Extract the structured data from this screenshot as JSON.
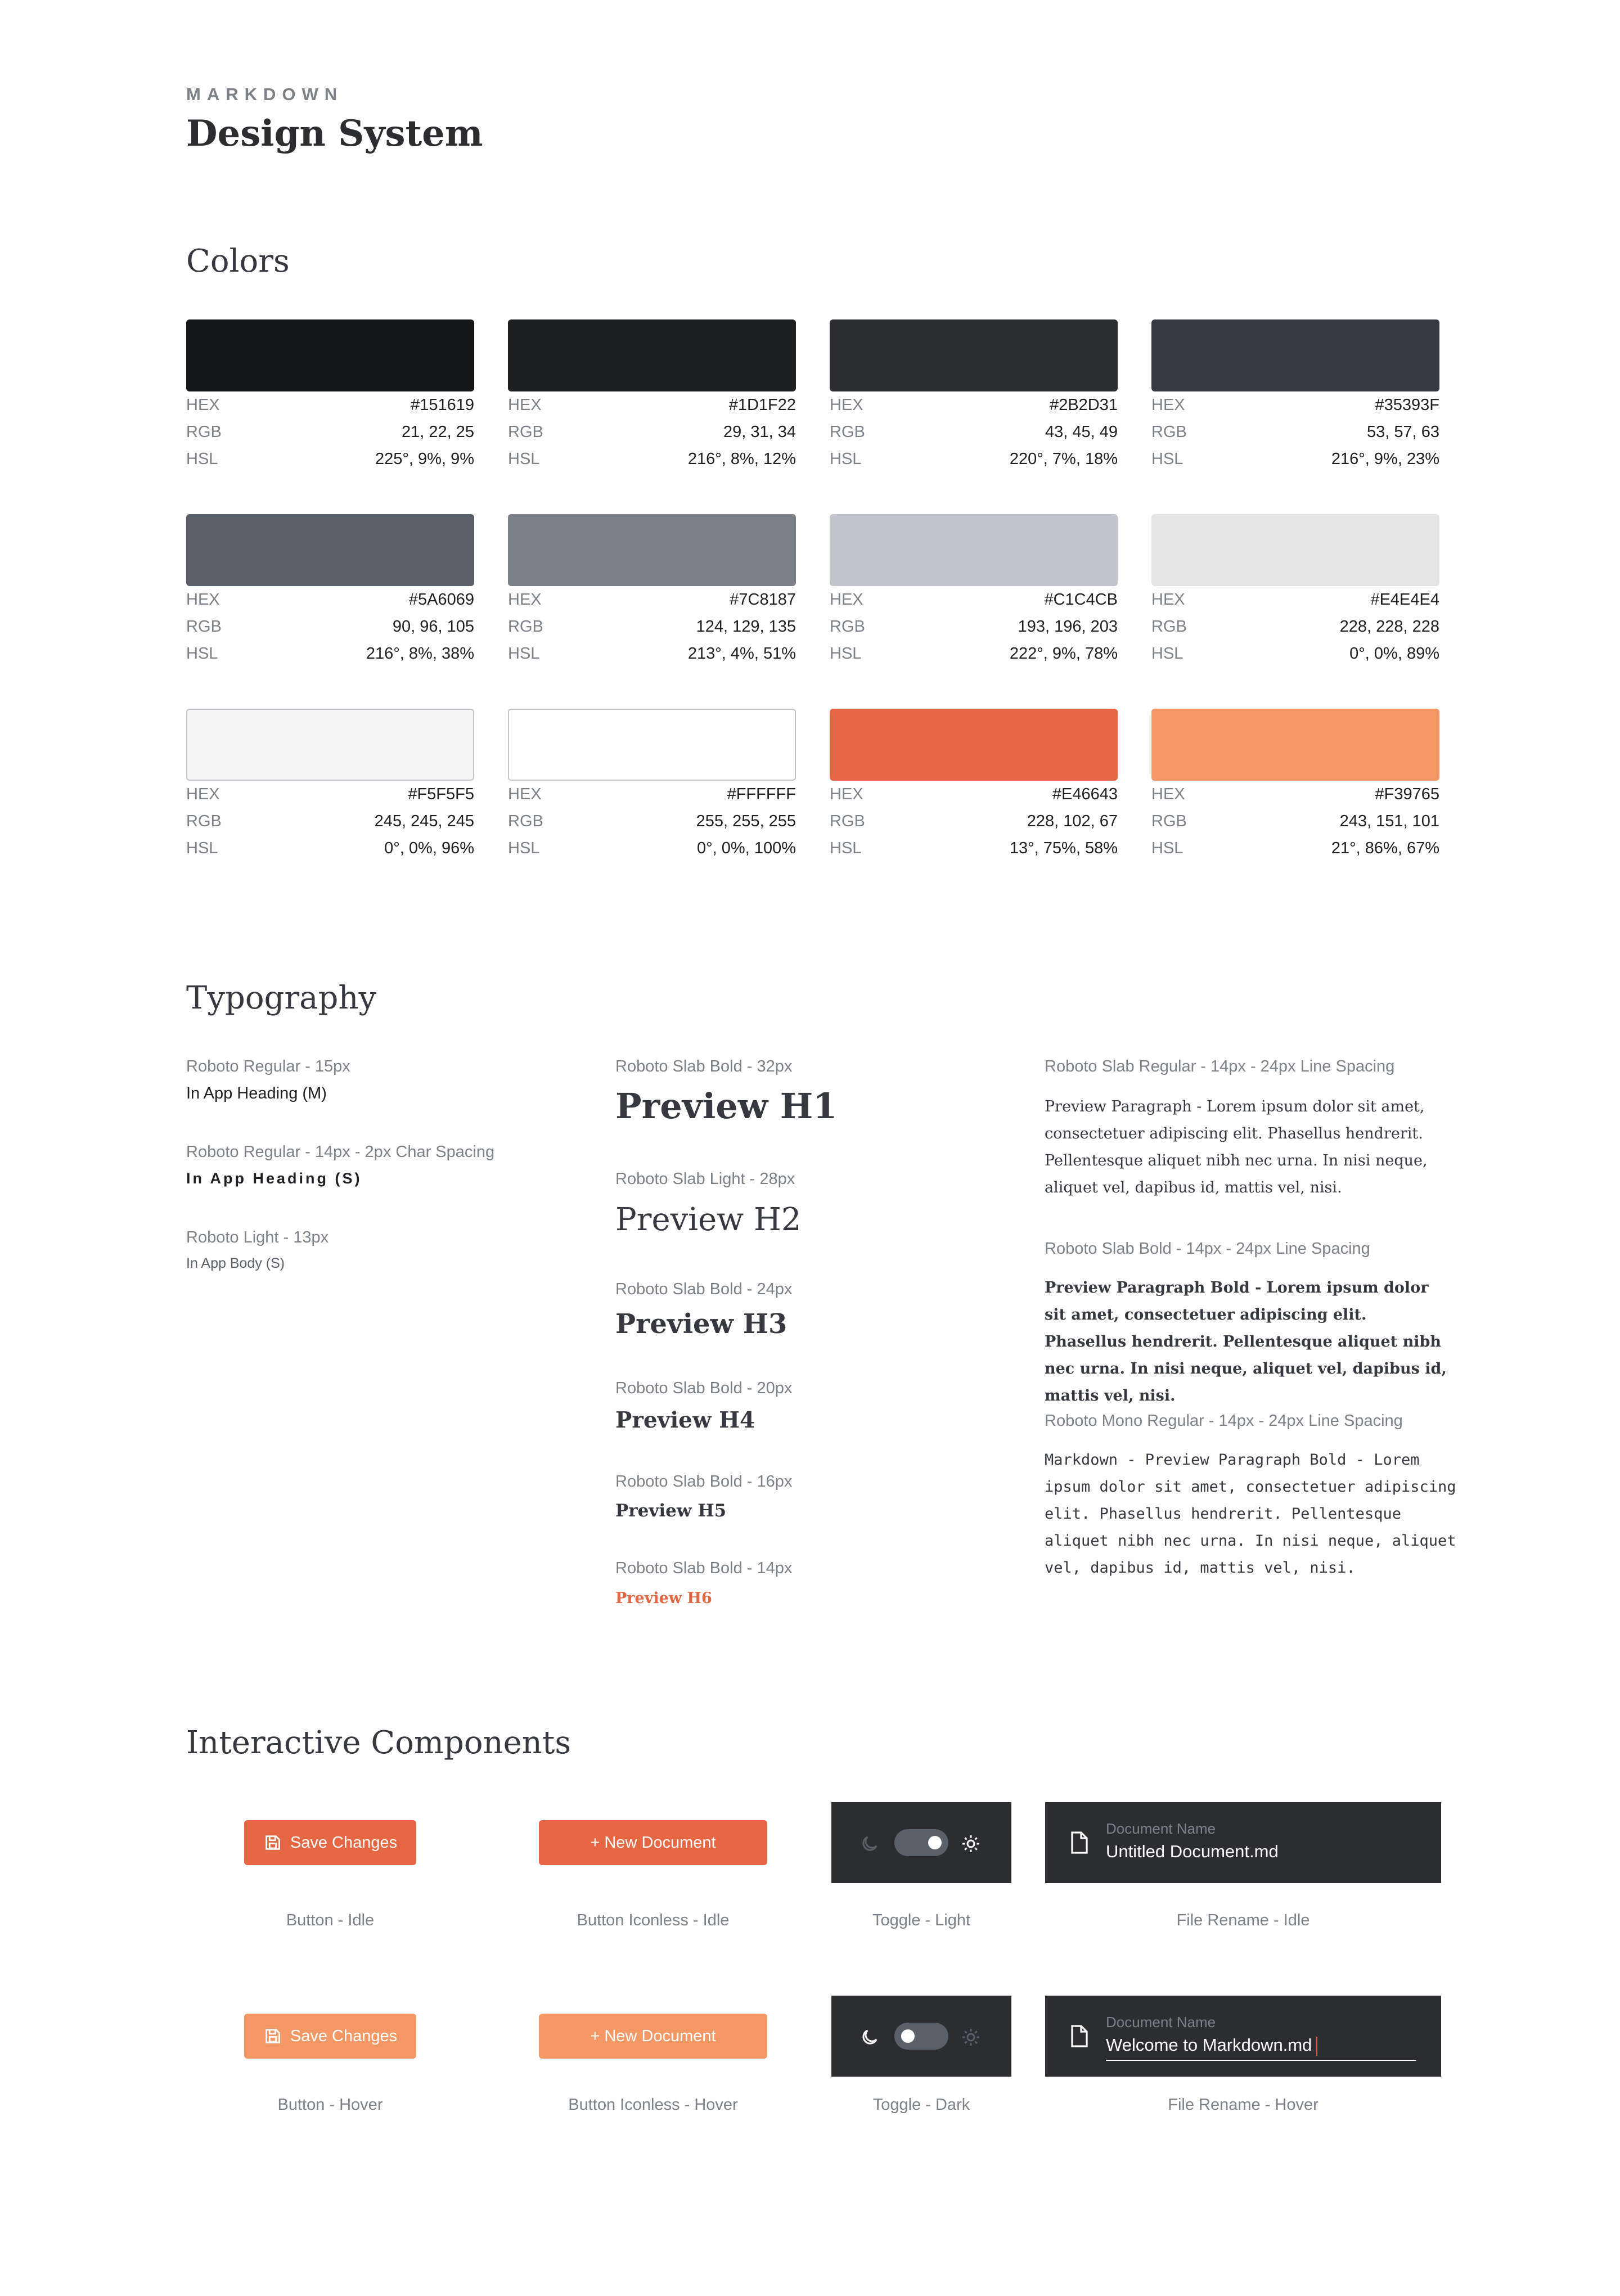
{
  "header": {
    "brand": "MARKDOWN",
    "title": "Design System"
  },
  "sections": {
    "colors": "Colors",
    "typography": "Typography",
    "components": "Interactive Components"
  },
  "colors": [
    {
      "hex": "#151619",
      "rgb": "21, 22, 25",
      "hsl": "225°, 9%, 9%"
    },
    {
      "hex": "#1D1F22",
      "rgb": "29, 31, 34",
      "hsl": "216°, 8%, 12%"
    },
    {
      "hex": "#2B2D31",
      "rgb": "43, 45, 49",
      "hsl": "220°, 7%, 18%"
    },
    {
      "hex": "#35393F",
      "rgb": "53, 57, 63",
      "hsl": "216°, 9%, 23%"
    },
    {
      "hex": "#5A6069",
      "rgb": "90, 96, 105",
      "hsl": "216°, 8%, 38%"
    },
    {
      "hex": "#7C8187",
      "rgb": "124, 129, 135",
      "hsl": "213°, 4%, 51%"
    },
    {
      "hex": "#C1C4CB",
      "rgb": "193, 196, 203",
      "hsl": "222°, 9%, 78%"
    },
    {
      "hex": "#E4E4E4",
      "rgb": "228, 228, 228",
      "hsl": "0°, 0%, 89%"
    },
    {
      "hex": "#F5F5F5",
      "rgb": "245, 245, 245",
      "hsl": "0°, 0%, 96%"
    },
    {
      "hex": "#FFFFFF",
      "rgb": "255, 255, 255",
      "hsl": "0°, 0%, 100%"
    },
    {
      "hex": "#E46643",
      "rgb": "228, 102, 67",
      "hsl": "13°, 75%, 58%"
    },
    {
      "hex": "#F39765",
      "rgb": "243, 151, 101",
      "hsl": "21°, 86%, 67%"
    }
  ],
  "color_keys": {
    "hex": "HEX",
    "rgb": "RGB",
    "hsl": "HSL"
  },
  "typography": {
    "left": [
      {
        "label": "Roboto Regular - 15px",
        "sample": "In App Heading (M)"
      },
      {
        "label": "Roboto Regular - 14px - 2px Char Spacing",
        "sample": "In App Heading (S)"
      },
      {
        "label": "Roboto Light - 13px",
        "sample": "In App Body (S)"
      }
    ],
    "middle": [
      {
        "label": "Roboto Slab Bold - 32px",
        "sample": "Preview H1"
      },
      {
        "label": "Roboto Slab Light - 28px",
        "sample": "Preview H2"
      },
      {
        "label": "Roboto Slab Bold - 24px",
        "sample": "Preview H3"
      },
      {
        "label": "Roboto Slab Bold - 20px",
        "sample": "Preview H4"
      },
      {
        "label": "Roboto Slab Bold - 16px",
        "sample": "Preview H5"
      },
      {
        "label": "Roboto Slab Bold - 14px",
        "sample": "Preview H6"
      }
    ],
    "right": [
      {
        "label": "Roboto Slab Regular - 14px - 24px Line Spacing",
        "sample": "Preview Paragraph - Lorem ipsum dolor sit amet, consectetuer adipiscing elit. Phasellus hendrerit. Pellentesque aliquet nibh nec urna. In nisi neque, aliquet vel, dapibus id, mattis vel, nisi."
      },
      {
        "label": "Roboto Slab Bold - 14px - 24px Line Spacing",
        "sample": "Preview Paragraph Bold -  Lorem ipsum dolor sit amet, consectetuer adipiscing elit. Phasellus hendrerit. Pellentesque aliquet nibh nec urna. In nisi neque, aliquet vel, dapibus id, mattis vel, nisi."
      },
      {
        "label": "Roboto Mono Regular - 14px - 24px Line Spacing",
        "sample": "Markdown - Preview Paragraph Bold - Lorem ipsum dolor sit amet, consectetuer adipiscing elit. Phasellus hendrerit. Pellentesque aliquet nibh nec urna. In nisi neque, aliquet vel, dapibus id, mattis vel, nisi."
      }
    ]
  },
  "components": {
    "save_label": "Save Changes",
    "new_doc_label": "+ New Document",
    "file_label": "Document Name",
    "file_idle_value": "Untitled Document.md",
    "file_hover_value": "Welcome to Markdown.md",
    "captions": {
      "button_idle": "Button - Idle",
      "button_iconless_idle": "Button Iconless - Idle",
      "toggle_light": "Toggle - Light",
      "file_idle": "File Rename - Idle",
      "button_hover": "Button - Hover",
      "button_iconless_hover": "Button Iconless - Hover",
      "toggle_dark": "Toggle - Dark",
      "file_hover": "File Rename - Hover"
    }
  }
}
